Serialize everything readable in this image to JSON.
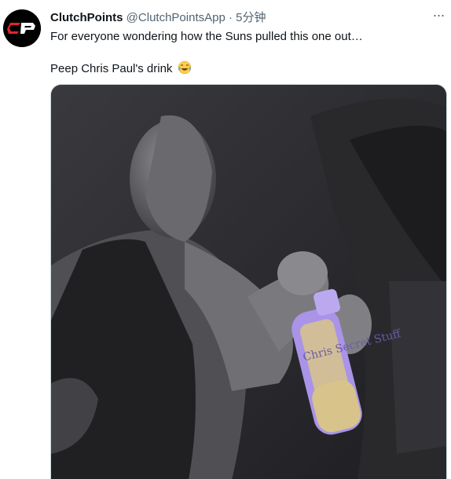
{
  "tweet": {
    "author_name": "ClutchPoints",
    "author_handle": "@ClutchPointsApp",
    "separator": "·",
    "timestamp": "5分钟",
    "more_label": "···",
    "text_line1": "For everyone wondering how the Suns pulled this one out…",
    "text_line2": "Peep Chris Paul's drink",
    "emoji": "face-with-tears-of-joy",
    "bottle_label": "Chris Secret Stuff"
  },
  "avatar": {
    "logo_text": "CP",
    "colors": {
      "bg": "#000000",
      "red": "#e0242b",
      "white": "#ffffff"
    }
  },
  "colors": {
    "text": "#0f1419",
    "secondary": "#536471",
    "bottle": "#a994e8",
    "liquid": "#d8c48a"
  }
}
